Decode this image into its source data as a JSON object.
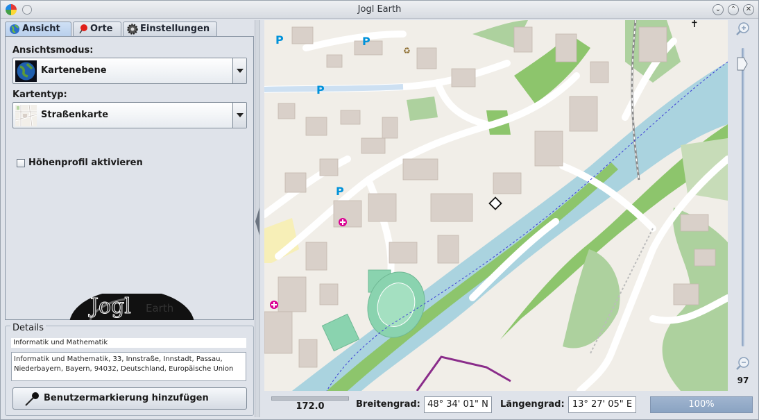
{
  "window": {
    "title": "Jogl Earth"
  },
  "tabs": [
    {
      "label": "Ansicht",
      "active": true,
      "icon": "globe-icon"
    },
    {
      "label": "Orte",
      "active": false,
      "icon": "pushpin-icon"
    },
    {
      "label": "Einstellungen",
      "active": false,
      "icon": "gear-icon"
    }
  ],
  "view": {
    "mode_label": "Ansichtsmodus:",
    "mode_value": "Kartenebene",
    "maptype_label": "Kartentyp:",
    "maptype_value": "Straßenkarte",
    "elevation_label": "Höhenprofil aktivieren",
    "elevation_checked": false
  },
  "logo": {
    "text": "Jogl Earth"
  },
  "details": {
    "legend": "Details",
    "name": "Informatik und Mathematik",
    "address": "Informatik und Mathematik, 33, Innstraße, Innstadt, Passau, Niederbayern, Bayern, 94032, Deutschland, Europäische Union",
    "add_button": "Benutzermarkierung hinzufügen"
  },
  "zoom": {
    "value": "97",
    "level": 0.97
  },
  "status": {
    "altitude": "172.0",
    "lat_label": "Breitengrad:",
    "lat_value": "48° 34' 01\" N",
    "lon_label": "Längengrad:",
    "lon_value": "13° 27' 05\" E",
    "progress_label": "100%",
    "progress": 1.0
  },
  "colors": {
    "river": "#aad3df",
    "park": "#add19e",
    "forest": "#8dc56c",
    "building": "#d9d0c9",
    "pitch": "#8ad3af",
    "progress": "#8aa3c2",
    "boundary": "#8a2c8a"
  }
}
